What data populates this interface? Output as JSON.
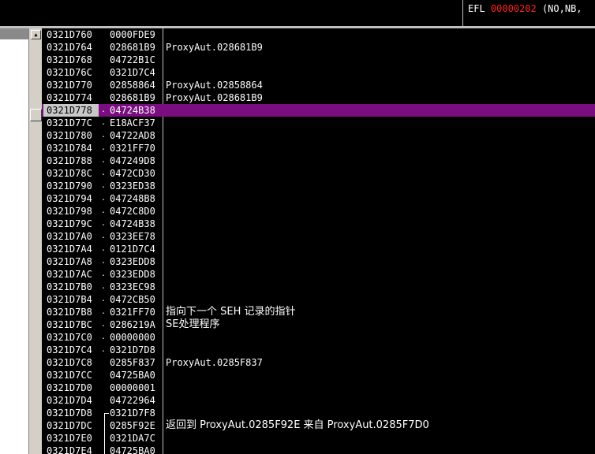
{
  "registers": {
    "efl_label": "EFL",
    "efl_value": "00000202",
    "efl_flags": "(NO,NB,"
  },
  "stack": {
    "rows": [
      {
        "addr": "0321D760",
        "sep": "",
        "val": "0000FDE9",
        "comment": ""
      },
      {
        "addr": "0321D764",
        "sep": "",
        "val": "028681B9",
        "comment": "ProxyAut.028681B9"
      },
      {
        "addr": "0321D768",
        "sep": "",
        "val": "04722B1C",
        "comment": ""
      },
      {
        "addr": "0321D76C",
        "sep": "",
        "val": "0321D7C4",
        "comment": ""
      },
      {
        "addr": "0321D770",
        "sep": "",
        "val": "02858864",
        "comment": "ProxyAut.02858864"
      },
      {
        "addr": "0321D774",
        "sep": "",
        "val": "028681B9",
        "comment": "ProxyAut.028681B9"
      },
      {
        "addr": "0321D778",
        "sep": ".",
        "val": "04724B38",
        "comment": "",
        "selected": true
      },
      {
        "addr": "0321D77C",
        "sep": ".",
        "val": "E18ACF37",
        "comment": ""
      },
      {
        "addr": "0321D780",
        "sep": ".",
        "val": "04722AD8",
        "comment": ""
      },
      {
        "addr": "0321D784",
        "sep": ".",
        "val": "0321FF70",
        "comment": ""
      },
      {
        "addr": "0321D788",
        "sep": ".",
        "val": "047249D8",
        "comment": ""
      },
      {
        "addr": "0321D78C",
        "sep": ".",
        "val": "0472CD30",
        "comment": ""
      },
      {
        "addr": "0321D790",
        "sep": ".",
        "val": "0323ED38",
        "comment": ""
      },
      {
        "addr": "0321D794",
        "sep": ".",
        "val": "047248B8",
        "comment": ""
      },
      {
        "addr": "0321D798",
        "sep": ".",
        "val": "0472C8D0",
        "comment": ""
      },
      {
        "addr": "0321D79C",
        "sep": ".",
        "val": "04724B38",
        "comment": ""
      },
      {
        "addr": "0321D7A0",
        "sep": ".",
        "val": "0323EE78",
        "comment": ""
      },
      {
        "addr": "0321D7A4",
        "sep": ".",
        "val": "0121D7C4",
        "comment": ""
      },
      {
        "addr": "0321D7A8",
        "sep": ".",
        "val": "0323EDD8",
        "comment": ""
      },
      {
        "addr": "0321D7AC",
        "sep": ".",
        "val": "0323EDD8",
        "comment": ""
      },
      {
        "addr": "0321D7B0",
        "sep": ".",
        "val": "0323EC98",
        "comment": ""
      },
      {
        "addr": "0321D7B4",
        "sep": ".",
        "val": "0472CB50",
        "comment": ""
      },
      {
        "addr": "0321D7B8",
        "sep": ".",
        "val": "0321FF70",
        "comment": "指向下一个 SEH 记录的指针"
      },
      {
        "addr": "0321D7BC",
        "sep": ".",
        "val": "0286219A",
        "comment": "SE处理程序"
      },
      {
        "addr": "0321D7C0",
        "sep": ".",
        "val": "00000000",
        "comment": ""
      },
      {
        "addr": "0321D7C4",
        "sep": ".",
        "val": "0321D7D8",
        "comment": ""
      },
      {
        "addr": "0321D7C8",
        "sep": "",
        "val": "0285F837",
        "comment": "ProxyAut.0285F837"
      },
      {
        "addr": "0321D7CC",
        "sep": "",
        "val": "04725BA0",
        "comment": ""
      },
      {
        "addr": "0321D7D0",
        "sep": "",
        "val": "00000001",
        "comment": ""
      },
      {
        "addr": "0321D7D4",
        "sep": "",
        "val": "04722964",
        "comment": ""
      },
      {
        "addr": "0321D7D8",
        "sep": "",
        "val": "0321D7F8",
        "comment": ""
      },
      {
        "addr": "0321D7DC",
        "sep": "",
        "val": "0285F92E",
        "comment": "返回到 ProxyAut.0285F92E 来自 ProxyAut.0285F7D0"
      },
      {
        "addr": "0321D7E0",
        "sep": "",
        "val": "0321DA7C",
        "comment": ""
      },
      {
        "addr": "0321D7E4",
        "sep": "",
        "val": "04725BA0",
        "comment": ""
      }
    ]
  }
}
